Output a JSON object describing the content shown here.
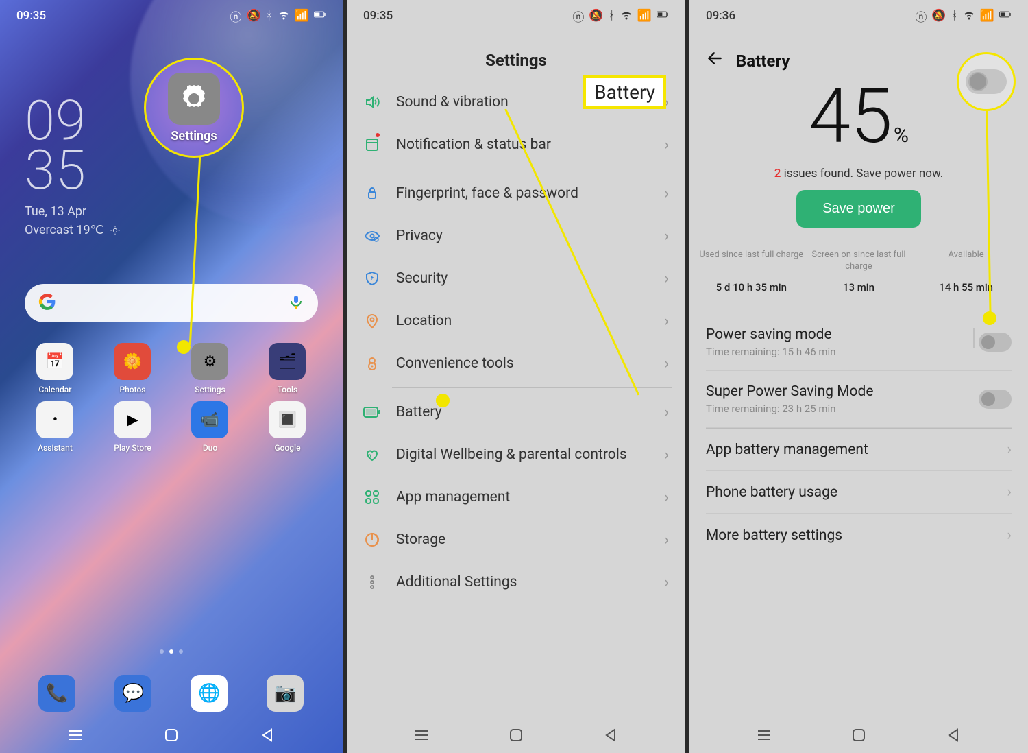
{
  "panel1": {
    "status_time": "09:35",
    "clock_h": "09",
    "clock_m": "35",
    "date": "Tue, 13 Apr",
    "weather": "Overcast 19℃",
    "apps": [
      {
        "label": "Calendar",
        "bg": "#f4f4f4",
        "emoji": "📅"
      },
      {
        "label": "Photos",
        "bg": "#e14b3b",
        "emoji": "🌼"
      },
      {
        "label": "Settings",
        "bg": "#8a8a8a",
        "emoji": "⚙"
      },
      {
        "label": "Tools",
        "bg": "#383d78",
        "emoji": "🗂"
      },
      {
        "label": "Assistant",
        "bg": "#f4f4f4",
        "emoji": "•"
      },
      {
        "label": "Play Store",
        "bg": "#f4f4f4",
        "emoji": "▶"
      },
      {
        "label": "Duo",
        "bg": "#2d77e6",
        "emoji": "📹"
      },
      {
        "label": "Google",
        "bg": "#f4f4f4",
        "emoji": "🔳"
      }
    ],
    "dock": [
      {
        "name": "phone",
        "bg": "#3a73d9",
        "emoji": "📞"
      },
      {
        "name": "messages",
        "bg": "#3a73d9",
        "emoji": "💬"
      },
      {
        "name": "chrome",
        "bg": "#fff",
        "emoji": "🌐"
      },
      {
        "name": "camera",
        "bg": "#d6d6d6",
        "emoji": "📷"
      }
    ],
    "zoom_label": "Settings"
  },
  "panel2": {
    "status_time": "09:35",
    "title": "Settings",
    "items": [
      {
        "icon": "sound",
        "label": "Sound & vibration",
        "color": "#2fb174"
      },
      {
        "icon": "notif",
        "label": "Notification & status bar",
        "color": "#2fb174",
        "has_dot": true
      },
      {
        "icon": "finger",
        "label": "Fingerprint, face & password",
        "color": "#3a86d9"
      },
      {
        "icon": "privacy",
        "label": "Privacy",
        "color": "#3a86d9"
      },
      {
        "icon": "security",
        "label": "Security",
        "color": "#3a86d9"
      },
      {
        "icon": "location",
        "label": "Location",
        "color": "#e8914c"
      },
      {
        "icon": "convenience",
        "label": "Convenience tools",
        "color": "#e8914c"
      },
      {
        "icon": "battery",
        "label": "Battery",
        "color": "#2fb174"
      },
      {
        "icon": "wellbeing",
        "label": "Digital Wellbeing & parental controls",
        "color": "#2fb174"
      },
      {
        "icon": "apps",
        "label": "App management",
        "color": "#2fb174"
      },
      {
        "icon": "storage",
        "label": "Storage",
        "color": "#e8914c"
      },
      {
        "icon": "additional",
        "label": "Additional Settings",
        "color": "#888"
      }
    ],
    "callout": "Battery"
  },
  "panel3": {
    "status_time": "09:36",
    "title": "Battery",
    "pct": "45",
    "pct_sym": "%",
    "issues_count": "2",
    "issues_text": " issues found. Save power now.",
    "save_label": "Save power",
    "stats": [
      {
        "label": "Used since last full charge",
        "value": "5 d 10 h 35 min"
      },
      {
        "label": "Screen on since last full charge",
        "value": "13 min"
      },
      {
        "label": "Available",
        "value": "14 h 55 min"
      }
    ],
    "rows": [
      {
        "title": "Power saving mode",
        "sub": "Time remaining:  15 h 46 min",
        "type": "toggle"
      },
      {
        "title": "Super Power Saving Mode",
        "sub": "Time remaining:  23 h 25 min",
        "type": "toggle"
      },
      {
        "title": "App battery management",
        "type": "chev"
      },
      {
        "title": "Phone battery usage",
        "type": "chev"
      },
      {
        "title": "More battery settings",
        "type": "chev"
      }
    ]
  },
  "status_icons": [
    "nfc",
    "dnd",
    "bluetooth",
    "wifi",
    "data",
    "battery"
  ]
}
